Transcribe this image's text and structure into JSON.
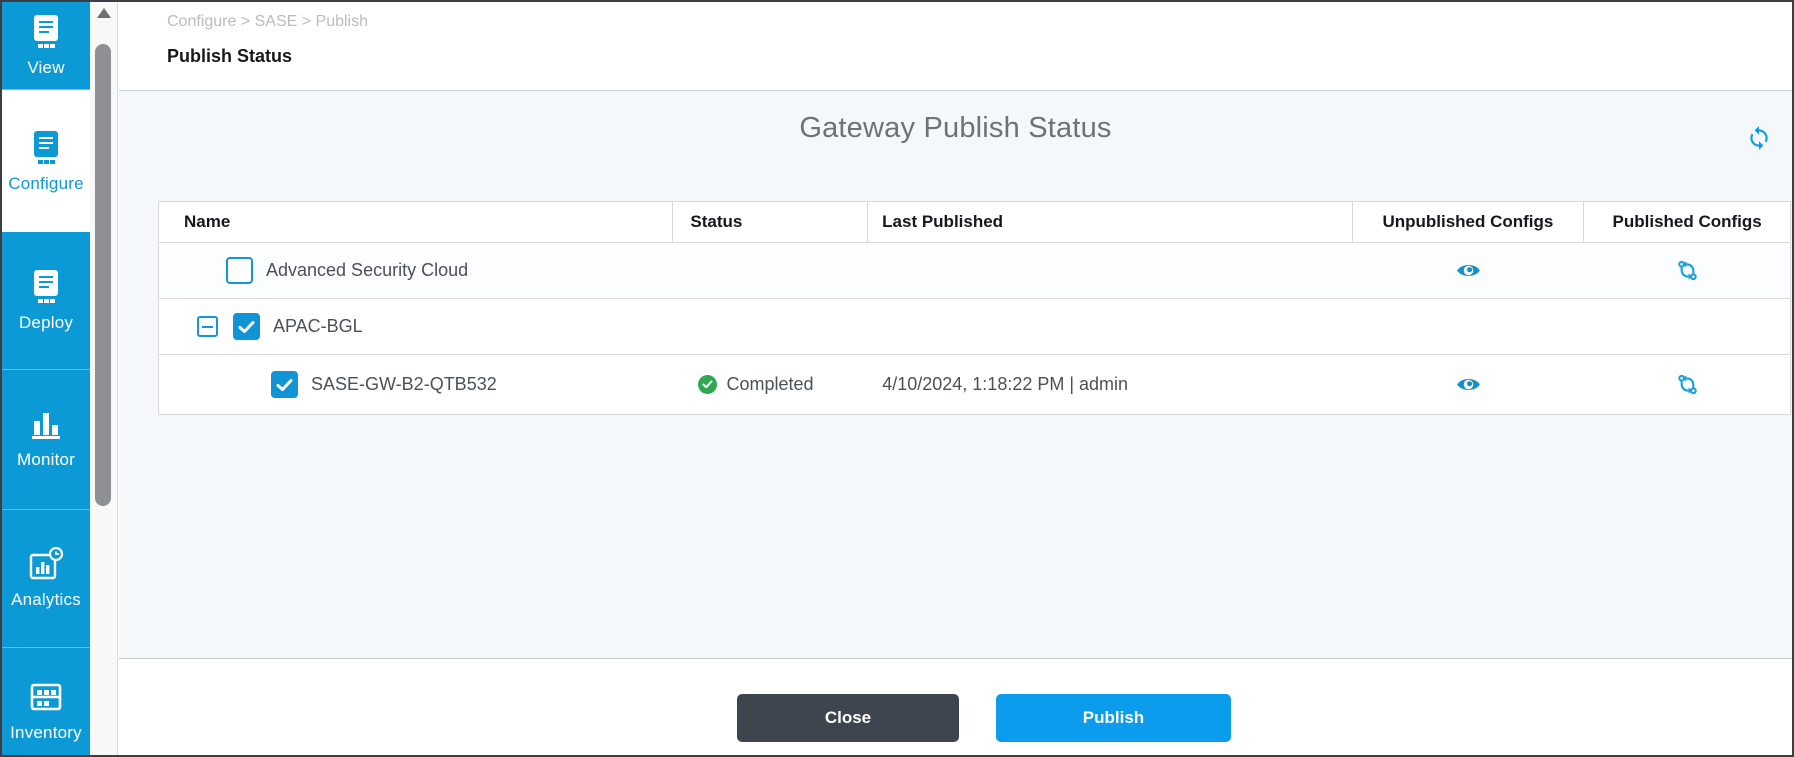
{
  "sidebar": {
    "items": [
      {
        "label": "View",
        "icon": "document-icon",
        "active": false
      },
      {
        "label": "Configure",
        "icon": "document-icon",
        "active": true
      },
      {
        "label": "Deploy",
        "icon": "document-icon",
        "active": false
      },
      {
        "label": "Monitor",
        "icon": "bar-chart-icon",
        "active": false
      },
      {
        "label": "Analytics",
        "icon": "analytics-clock-icon",
        "active": false
      },
      {
        "label": "Inventory",
        "icon": "inventory-rack-icon",
        "active": false
      }
    ]
  },
  "header": {
    "breadcrumb": "Configure > SASE > Publish",
    "title": "Publish Status"
  },
  "panel": {
    "title": "Gateway Publish Status",
    "refresh_icon": "refresh-icon"
  },
  "table": {
    "columns": [
      "Name",
      "Status",
      "Last Published",
      "Unpublished Configs",
      "Published Configs"
    ],
    "rows": [
      {
        "name": "Advanced Security Cloud",
        "checked": false,
        "expander": null,
        "indent": 1,
        "status": "",
        "last_published": "",
        "unpublished_icon": "eye-icon",
        "published_icon": "compare-configs-icon"
      },
      {
        "name": "APAC-BGL",
        "checked": true,
        "expander": "expanded",
        "indent": 0,
        "status": "",
        "last_published": "",
        "unpublished_icon": null,
        "published_icon": null
      },
      {
        "name": "SASE-GW-B2-QTB532",
        "checked": true,
        "expander": null,
        "indent": 2,
        "status": "Completed",
        "status_state": "success",
        "last_published": "4/10/2024, 1:18:22 PM | admin",
        "unpublished_icon": "eye-icon",
        "published_icon": "compare-configs-icon"
      }
    ]
  },
  "footer": {
    "close_label": "Close",
    "publish_label": "Publish"
  },
  "colors": {
    "sidebar_blue": "#0c9ad6",
    "accent_blue": "#0c9ced",
    "checkbox_blue": "#1094d6",
    "success_green": "#2fa84f",
    "close_button_dark": "#3f454e",
    "panel_background": "#f4f8fb"
  }
}
